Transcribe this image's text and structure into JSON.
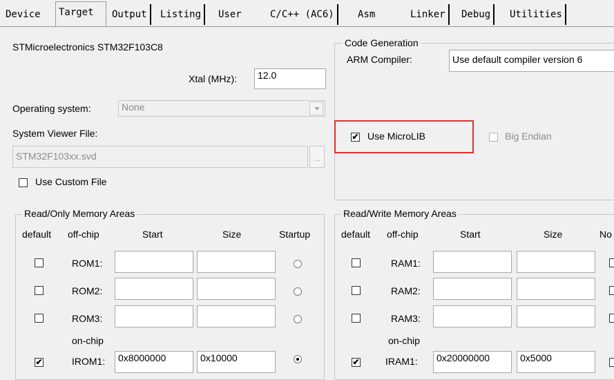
{
  "tabs": [
    "Device",
    "Target",
    "Output",
    "Listing",
    "User",
    "C/C++ (AC6)",
    "Asm",
    "Linker",
    "Debug",
    "Utilities"
  ],
  "device_name": "STMicroelectronics STM32F103C8",
  "xtal": {
    "label": "Xtal (MHz):",
    "value": "12.0"
  },
  "os": {
    "label": "Operating system:",
    "value": "None"
  },
  "svf": {
    "label": "System Viewer File:",
    "value": "STM32F103xx.svd",
    "browse": "...",
    "custom_label": "Use Custom File"
  },
  "codegen": {
    "title": "Code Generation",
    "compiler_label": "ARM Compiler:",
    "compiler_value": "Use default compiler version 6",
    "microlib_label": "Use MicroLIB",
    "microlib_checked": true,
    "bigendian_label": "Big Endian"
  },
  "ro": {
    "title": "Read/Only Memory Areas",
    "headers": [
      "default",
      "off-chip",
      "Start",
      "Size",
      "Startup"
    ],
    "onchip_label": "on-chip",
    "rows": [
      {
        "label": "ROM1:",
        "start": "",
        "size": "",
        "default": false,
        "startup": false
      },
      {
        "label": "ROM2:",
        "start": "",
        "size": "",
        "default": false,
        "startup": false
      },
      {
        "label": "ROM3:",
        "start": "",
        "size": "",
        "default": false,
        "startup": false
      },
      {
        "label": "IROM1:",
        "start": "0x8000000",
        "size": "0x10000",
        "default": true,
        "startup": true
      }
    ]
  },
  "rw": {
    "title": "Read/Write Memory Areas",
    "headers": [
      "default",
      "off-chip",
      "Start",
      "Size",
      "No"
    ],
    "onchip_label": "on-chip",
    "rows": [
      {
        "label": "RAM1:",
        "start": "",
        "size": "",
        "default": false
      },
      {
        "label": "RAM2:",
        "start": "",
        "size": "",
        "default": false
      },
      {
        "label": "RAM3:",
        "start": "",
        "size": "",
        "default": false
      },
      {
        "label": "IRAM1:",
        "start": "0x20000000",
        "size": "0x5000",
        "default": true
      }
    ]
  },
  "check_mark": "✔"
}
